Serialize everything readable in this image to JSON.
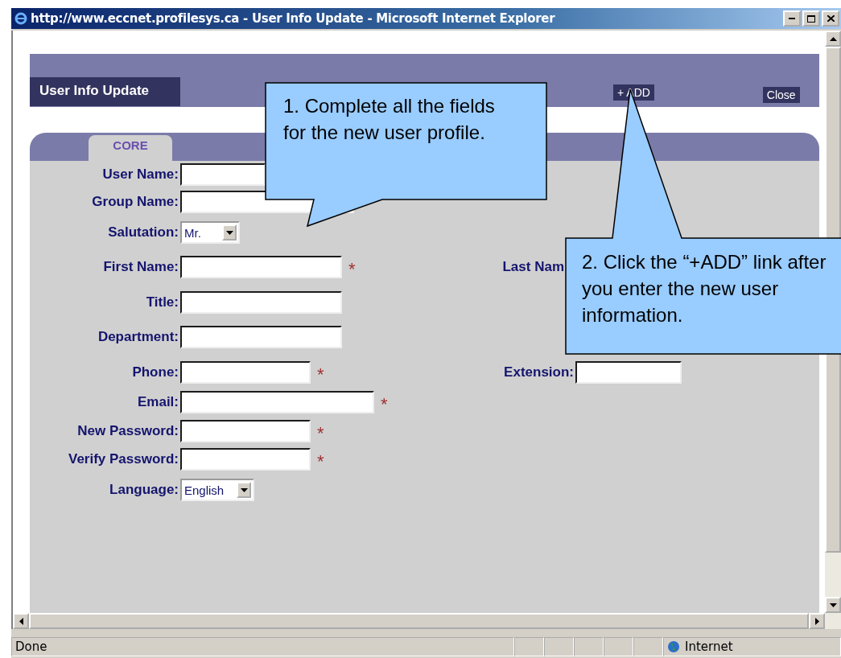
{
  "window": {
    "title": "http://www.eccnet.profilesys.ca - User Info Update - Microsoft Internet Explorer"
  },
  "header": {
    "title": "User Info Update",
    "add_link": "+ ADD",
    "close_link": "Close"
  },
  "tabs": [
    {
      "label": "CORE",
      "selected": true
    }
  ],
  "form_rows": [
    {
      "left": {
        "label": "User Name:",
        "kind": "text"
      }
    },
    {
      "left": {
        "label": "Group Name:",
        "kind": "text"
      }
    },
    {
      "left": {
        "label": "Salutation:",
        "kind": "select",
        "value": "Mr."
      }
    },
    {
      "left": {
        "label": "First Name:",
        "kind": "text",
        "marker": "*"
      },
      "right": {
        "label": "Last Nam",
        "kind": "label"
      }
    },
    {
      "left": {
        "label": "Title:",
        "kind": "text"
      }
    },
    {
      "left": {
        "label": "Department:",
        "kind": "text"
      }
    },
    {
      "left": {
        "label": "Phone:",
        "kind": "text",
        "marker": "*"
      },
      "right": {
        "label": "Extension:",
        "kind": "text"
      }
    },
    {
      "left": {
        "label": "Email:",
        "kind": "text",
        "marker": "*"
      }
    },
    {
      "left": {
        "label": "New Password:",
        "kind": "text",
        "marker": "*"
      }
    },
    {
      "left": {
        "label": "Verify Password:",
        "kind": "text",
        "marker": "*"
      }
    },
    {
      "left": {
        "label": "Language:",
        "kind": "select",
        "value": "English"
      }
    }
  ],
  "callouts": [
    {
      "text": "1. Complete all the fields for the new user profile."
    },
    {
      "text": "2. Click the “+ADD” link after you enter the new user information."
    }
  ],
  "status_bar": {
    "status": "Done",
    "zone": "Internet"
  }
}
